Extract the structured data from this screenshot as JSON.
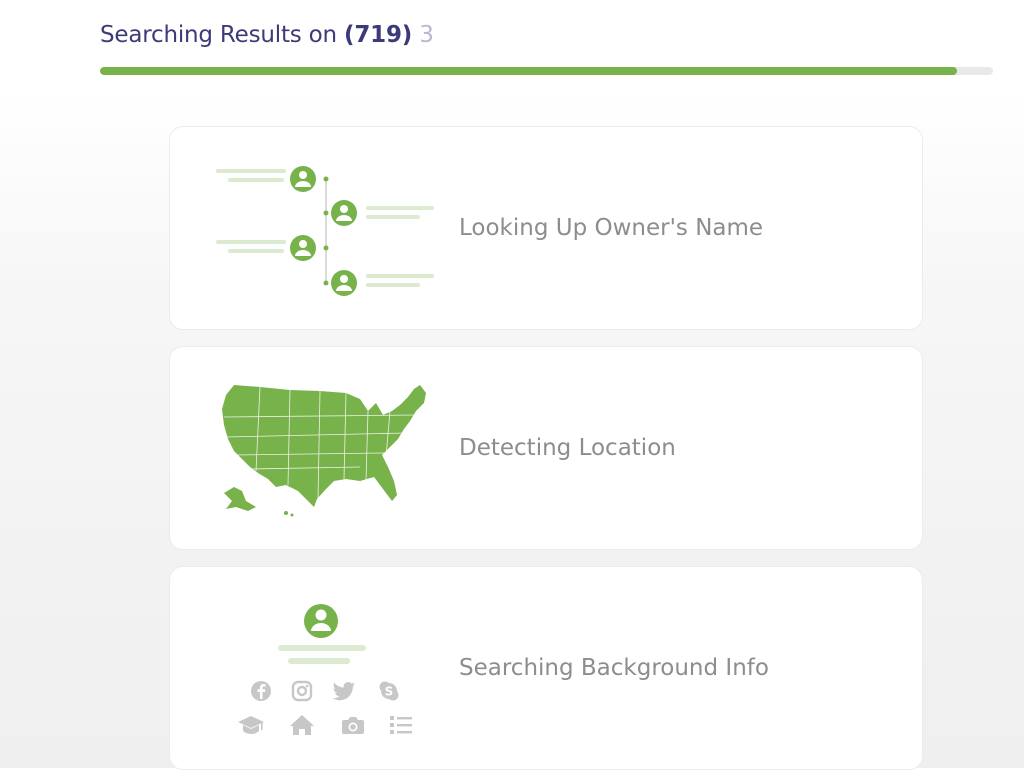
{
  "header": {
    "prefix": "Searching Results on ",
    "count": "(719)",
    "trailing": " 3"
  },
  "progress": {
    "percent": 96
  },
  "colors": {
    "accent_green": "#78b24a",
    "light_green": "#dcebd0",
    "title_purple": "#3d3a78",
    "label_gray": "#8d8d8d",
    "icon_gray": "#c7c7c7"
  },
  "steps": [
    {
      "label": "Looking Up Owner's Name",
      "illustration": "people-tree-icon"
    },
    {
      "label": "Detecting Location",
      "illustration": "usa-map-icon"
    },
    {
      "label": "Searching Background Info",
      "illustration": "profile-icon",
      "icons": [
        "facebook-icon",
        "instagram-icon",
        "twitter-icon",
        "skype-icon",
        "graduation-cap-icon",
        "home-icon",
        "camera-icon",
        "list-icon"
      ]
    }
  ]
}
